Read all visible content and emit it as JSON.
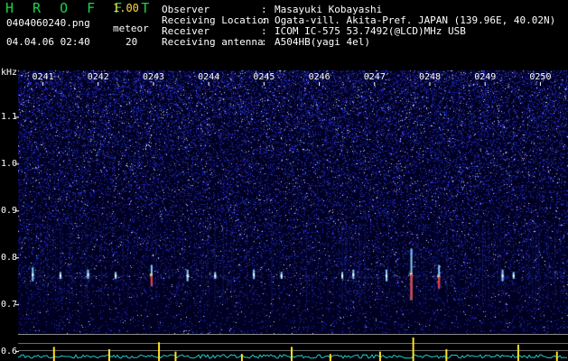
{
  "header": {
    "app_name": "H R O F F T",
    "app_version": "1.00",
    "file_name": "0404060240.png",
    "datetime": "04.04.06 02:40",
    "meteor_label": "meteor",
    "meteor_count": "20"
  },
  "info": [
    {
      "label": "Observer",
      "value": "Masayuki Kobayashi"
    },
    {
      "label": "Receiving Location",
      "value": "Ogata-vill. Akita-Pref. JAPAN (139.96E, 40.02N)"
    },
    {
      "label": "Receiver",
      "value": "ICOM IC-575 53.7492(@LCD)MHz USB"
    },
    {
      "label": "Receiving antenna",
      "value": "A504HB(yagi 4el)"
    }
  ],
  "colon": ":",
  "colors": {
    "logo": "#19d34a",
    "version": "#ffd84a",
    "background": "#000000",
    "noise": "#2a2fb8",
    "echo_hot": "#ff3030",
    "level_trace": "#1ec8d8",
    "level_spike": "#ffe020"
  },
  "chart_data": {
    "type": "heatmap",
    "ylabel": "kHz",
    "ylim": [
      0.58,
      1.2
    ],
    "yticks": [
      "1.1",
      "1.0",
      "0.9",
      "0.8",
      "0.7",
      "0.6"
    ],
    "ytick_values": [
      1.1,
      1.0,
      0.9,
      0.8,
      0.7,
      0.6
    ],
    "xticks": [
      "0241",
      "0242",
      "0243",
      "0244",
      "0245",
      "0246",
      "0247",
      "0248",
      "0249",
      "0250"
    ],
    "xtick_values": [
      241,
      242,
      243,
      244,
      245,
      246,
      247,
      248,
      249,
      250
    ],
    "xlim": [
      240.55,
      250.5
    ],
    "echo_band_khz": 0.76,
    "echoes": [
      {
        "time": 240.8,
        "f_top": 0.78,
        "f_bottom": 0.75,
        "hot": false
      },
      {
        "time": 241.3,
        "f_top": 0.77,
        "f_bottom": 0.755,
        "hot": false
      },
      {
        "time": 241.8,
        "f_top": 0.775,
        "f_bottom": 0.755,
        "hot": false
      },
      {
        "time": 242.3,
        "f_top": 0.77,
        "f_bottom": 0.755,
        "hot": false
      },
      {
        "time": 242.95,
        "f_top": 0.785,
        "f_bottom": 0.74,
        "hot": true
      },
      {
        "time": 243.6,
        "f_top": 0.775,
        "f_bottom": 0.75,
        "hot": false
      },
      {
        "time": 244.1,
        "f_top": 0.77,
        "f_bottom": 0.755,
        "hot": false
      },
      {
        "time": 244.8,
        "f_top": 0.775,
        "f_bottom": 0.755,
        "hot": false
      },
      {
        "time": 245.3,
        "f_top": 0.77,
        "f_bottom": 0.755,
        "hot": false
      },
      {
        "time": 246.4,
        "f_top": 0.77,
        "f_bottom": 0.755,
        "hot": false
      },
      {
        "time": 246.6,
        "f_top": 0.775,
        "f_bottom": 0.755,
        "hot": false
      },
      {
        "time": 247.2,
        "f_top": 0.775,
        "f_bottom": 0.75,
        "hot": false
      },
      {
        "time": 247.65,
        "f_top": 0.82,
        "f_bottom": 0.71,
        "hot": true
      },
      {
        "time": 248.15,
        "f_top": 0.785,
        "f_bottom": 0.735,
        "hot": true
      },
      {
        "time": 249.3,
        "f_top": 0.775,
        "f_bottom": 0.75,
        "hot": false
      },
      {
        "time": 249.5,
        "f_top": 0.77,
        "f_bottom": 0.755,
        "hot": false
      }
    ],
    "level_spikes": [
      {
        "time": 241.2,
        "level": 0.6
      },
      {
        "time": 242.2,
        "level": 0.5
      },
      {
        "time": 243.1,
        "level": 0.8
      },
      {
        "time": 243.4,
        "level": 0.4
      },
      {
        "time": 244.6,
        "level": 0.3
      },
      {
        "time": 245.5,
        "level": 0.6
      },
      {
        "time": 246.2,
        "level": 0.3
      },
      {
        "time": 247.1,
        "level": 0.4
      },
      {
        "time": 247.7,
        "level": 1.0
      },
      {
        "time": 248.3,
        "level": 0.5
      },
      {
        "time": 249.6,
        "level": 0.7
      },
      {
        "time": 250.3,
        "level": 0.4
      }
    ]
  }
}
